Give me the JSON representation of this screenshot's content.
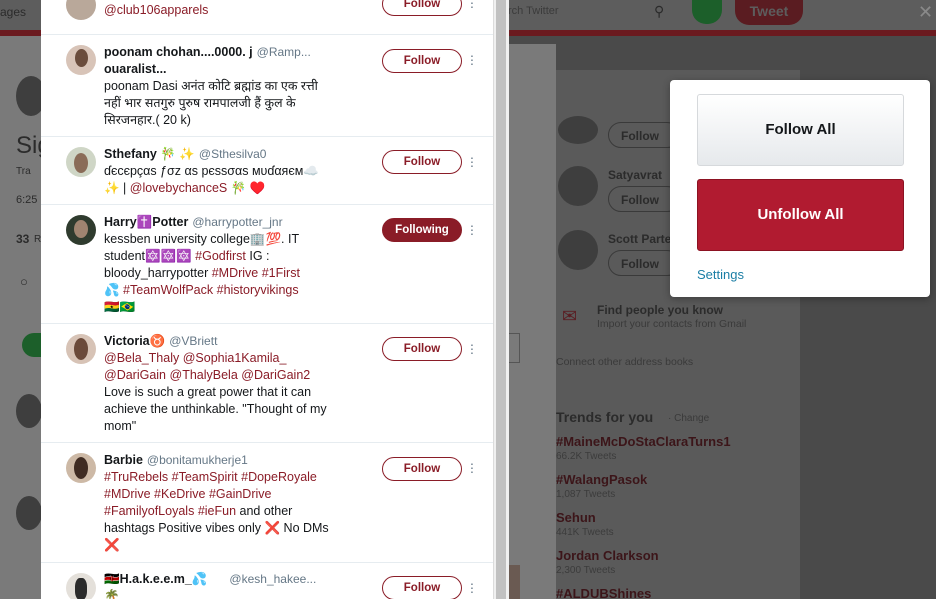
{
  "background": {
    "top_left_text": "ages",
    "search_placeholder": "rch Twitter",
    "tweet_button": "Tweet",
    "close_glyph": "✕",
    "profile_title": "Sig",
    "profile_meta": "Tra",
    "profile_time": "6:25",
    "profile_count": "33",
    "profile_count_suffix": "R",
    "right_items": [
      {
        "name": "Satyavrat",
        "button": "Follow"
      },
      {
        "name": "Scott Parte",
        "button": "Follow"
      }
    ],
    "right_top_button": "Follow",
    "find_people_title": "Find people you know",
    "find_people_sub": "Import your contacts from Gmail",
    "connect_text": "Connect other address books",
    "trends_title": "Trends for you",
    "trends_change": "· Change",
    "trends": [
      {
        "tag": "#MaineMcDoStaClaraTurns1",
        "count": "66.2K Tweets"
      },
      {
        "tag": "#WalangPasok",
        "count": "1,087 Tweets"
      },
      {
        "tag": "Sehun",
        "count": "441K Tweets"
      },
      {
        "tag": "Jordan Clarkson",
        "count": "2,300 Tweets"
      },
      {
        "tag": "#ALDUBShines",
        "count": ""
      }
    ]
  },
  "list": {
    "rows": [
      {
        "name": "",
        "handle": "",
        "bio": "@club106apparels",
        "button": "Follow"
      },
      {
        "name": "poonam chohan....0000. j",
        "name_line2": "ouaralist...",
        "handle": "@Ramp...",
        "bio": "poonam Dasi अनंत कोटि ब्रह्मांड का एक रत्ती नहीं भार सतगुरु पुरुष रामपालजी हैं कुल के सिरजनहार.( 20 k)",
        "button": "Follow"
      },
      {
        "name": "Sthefany",
        "name_emoji": "🎋 ✨",
        "handle": "@Sthesilva0",
        "bio": "ɗєcєpçαѕ ƒσz αѕ pєѕѕσαѕ мυɗαяєм☁️",
        "bio_line2": "✨ | ",
        "bio_tag": "@lovebychanceS",
        "bio_after": " 🎋 ♥️",
        "button": "Follow"
      },
      {
        "name": "Harry",
        "name_cross": "✝️",
        "name_rest": "Potter",
        "handle": "@harrypotter_jnr",
        "bio1": "kessben university college🏢💯. IT",
        "bio2_prefix": "student🔯🔯🔯 ",
        "bio2_tag": "#Godfirst",
        "bio2_suffix": " IG :",
        "bio3_prefix": "bloody_harrypotter ",
        "bio3_tag1": "#MDrive",
        "bio3_tag2": "#1First",
        "bio4_prefix": "💦 ",
        "bio4_tag1": "#TeamWolfPack",
        "bio4_tag2": "#historyvikings",
        "bio5": "🇬🇭🇧🇷",
        "button": "Following"
      },
      {
        "name": "Victoria",
        "name_emoji": "♉",
        "handle": "@VBriett",
        "tags1a": "@Bela_Thaly",
        "tags1b": "@Sophia1Kamila_",
        "tags2a": "@DariGain",
        "tags2b": "@ThalyBela",
        "tags2c": "@DariGain2",
        "bio": "Love is such a great power that it can achieve the unthinkable. \"Thought of my mom\"",
        "button": "Follow"
      },
      {
        "name": "Barbie",
        "handle": "@bonitamukherje1",
        "t1": "#TruRebels",
        "t2": "#TeamSpirit",
        "t3": "#DopeRoyale",
        "t4": "#MDrive",
        "t5": "#KeDrive",
        "t6": "#GainDrive",
        "t7": "#FamilyofLoyals",
        "t8": "#ieFun",
        "bio_rest": " and other hashtags Positive vibes only ❌ No DMs ❌",
        "button": "Follow"
      },
      {
        "name": "H.a.k.e.e.m_",
        "name_flag": "🇰🇪",
        "name_emoji": "💦",
        "handle": "@kesh_hakee...",
        "bio": "🌴",
        "button": "Follow"
      }
    ]
  },
  "popover": {
    "follow_all": "Follow All",
    "unfollow_all": "Unfollow All",
    "settings": "Settings"
  },
  "colors": {
    "accent": "#8a1c27",
    "unfollow_bg": "#b11b30",
    "link": "#1b7ea5"
  }
}
